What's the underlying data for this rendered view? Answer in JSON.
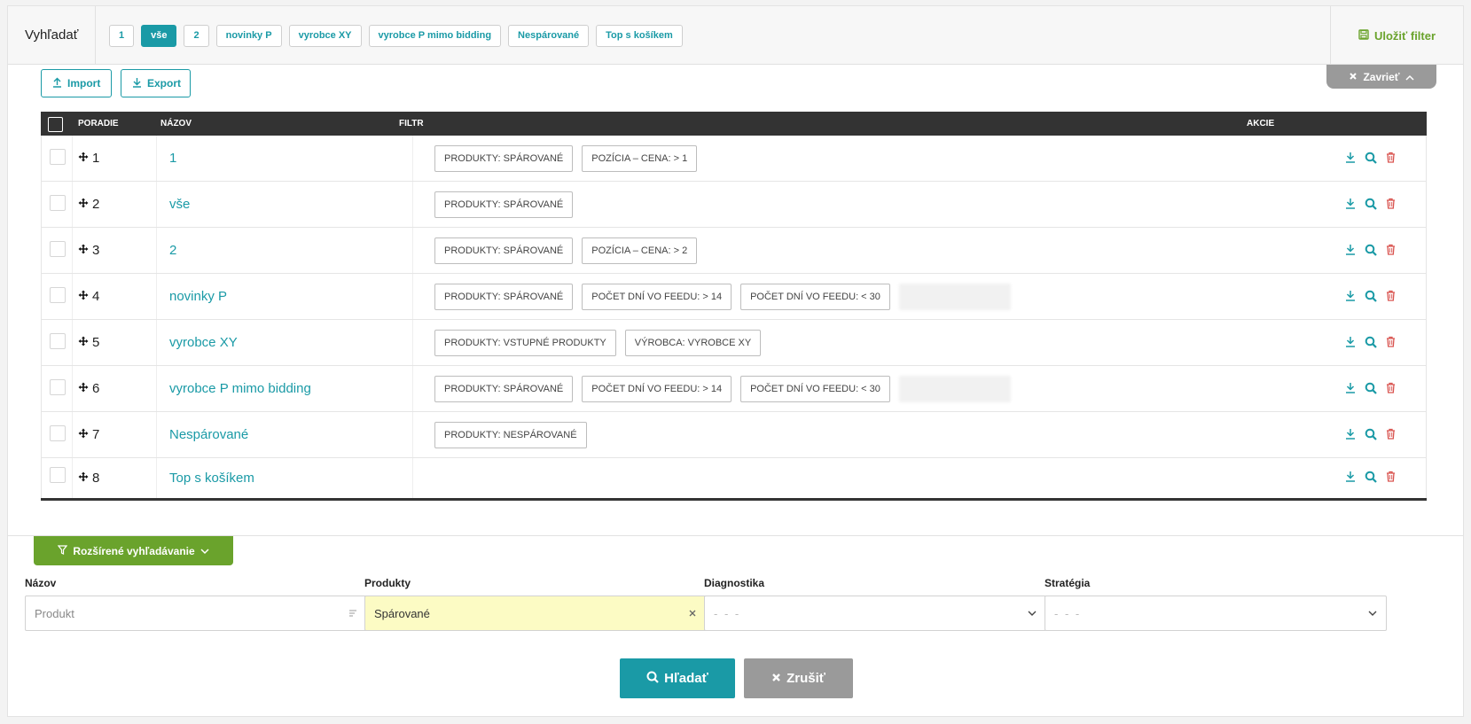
{
  "topbar": {
    "title": "Vyhľadať",
    "pills": [
      "1",
      "vše",
      "2",
      "novinky P",
      "vyrobce XY",
      "vyrobce P mimo bidding",
      "Nespárované",
      "Top s košíkem"
    ],
    "active_pill": "vše",
    "save_filter": "Uložiť filter"
  },
  "toolbar": {
    "import": "Import",
    "export": "Export",
    "close": "Zavrieť"
  },
  "table": {
    "headers": {
      "order": "PORADIE",
      "name": "NÁZOV",
      "filter": "FILTR",
      "actions": "AKCIE"
    },
    "rows": [
      {
        "order": "1",
        "name": "1",
        "tags": [
          "PRODUKTY: SPÁROVANÉ",
          "POZÍCIA – CENA: > 1"
        ],
        "blurred": false
      },
      {
        "order": "2",
        "name": "vše",
        "tags": [
          "PRODUKTY: SPÁROVANÉ"
        ],
        "blurred": false
      },
      {
        "order": "3",
        "name": "2",
        "tags": [
          "PRODUKTY: SPÁROVANÉ",
          "POZÍCIA – CENA: > 2"
        ],
        "blurred": false
      },
      {
        "order": "4",
        "name": "novinky P",
        "tags": [
          "PRODUKTY: SPÁROVANÉ",
          "POČET DNÍ VO FEEDU: > 14",
          "POČET DNÍ VO FEEDU: < 30"
        ],
        "blurred": true
      },
      {
        "order": "5",
        "name": "vyrobce XY",
        "tags": [
          "PRODUKTY: VSTUPNÉ PRODUKTY",
          "VÝROBCA: VYROBCE XY"
        ],
        "blurred": false
      },
      {
        "order": "6",
        "name": "vyrobce P mimo bidding",
        "tags": [
          "PRODUKTY: SPÁROVANÉ",
          "POČET DNÍ VO FEEDU: > 14",
          "POČET DNÍ VO FEEDU: < 30"
        ],
        "blurred": true
      },
      {
        "order": "7",
        "name": "Nespárované",
        "tags": [
          "PRODUKTY: NESPÁROVANÉ"
        ],
        "blurred": false
      },
      {
        "order": "8",
        "name": "Top s košíkem",
        "tags": [],
        "blurred": false
      }
    ]
  },
  "extended": {
    "toggle": "Rozšírené vyhľadávanie",
    "fields": {
      "name_label": "Názov",
      "name_placeholder": "Produkt",
      "products_label": "Produkty",
      "products_value": "Spárované",
      "diagnostics_label": "Diagnostika",
      "diagnostics_value": "- - -",
      "strategy_label": "Stratégia",
      "strategy_value": "- - -"
    },
    "search_button": "Hľadať",
    "cancel_button": "Zrušiť"
  },
  "colors": {
    "accent": "#1a9aa6",
    "green": "#6aa32c",
    "danger": "#d9534f",
    "header_dark": "#333333",
    "highlight": "#fcfbc4"
  },
  "icons": [
    "save-icon",
    "upload-icon",
    "download-icon",
    "close-icon",
    "chevron-up-icon",
    "move-icon",
    "search-icon",
    "trash-icon",
    "filter-icon",
    "chevron-down-icon",
    "lines-icon"
  ]
}
